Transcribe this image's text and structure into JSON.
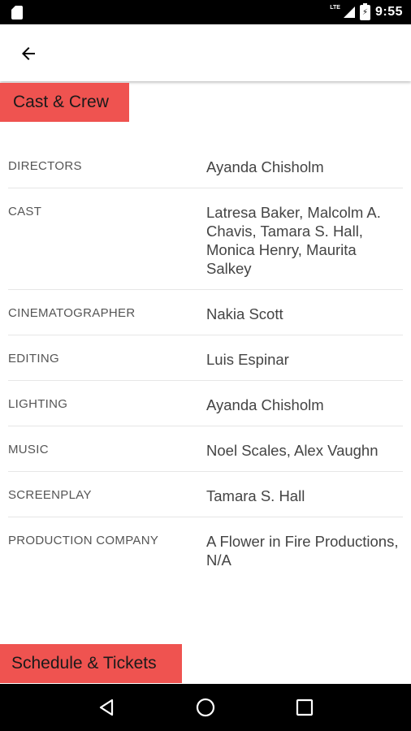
{
  "status_bar": {
    "time": "9:55",
    "network": "LTE",
    "icons": [
      "sim-icon",
      "lte-signal-icon",
      "battery-charging-icon"
    ]
  },
  "app_bar": {
    "back_icon": "arrow-back-icon"
  },
  "cast_section": {
    "title": "Cast & Crew"
  },
  "credits": [
    {
      "label": "DIRECTORS",
      "value": "Ayanda Chisholm"
    },
    {
      "label": "CAST",
      "value": "Latresa Baker, Malcolm A. Chavis, Tamara S. Hall, Monica Henry, Maurita Salkey"
    },
    {
      "label": "CINEMATOGRAPHER",
      "value": "Nakia Scott"
    },
    {
      "label": "EDITING",
      "value": "Luis Espinar"
    },
    {
      "label": "LIGHTING",
      "value": "Ayanda Chisholm"
    },
    {
      "label": "MUSIC",
      "value": "Noel Scales, Alex Vaughn"
    },
    {
      "label": "SCREENPLAY",
      "value": "Tamara S. Hall"
    },
    {
      "label": "PRODUCTION COMPANY",
      "value": "A Flower in Fire Productions, N/A"
    }
  ],
  "schedule_section": {
    "title": "Schedule & Tickets"
  },
  "nav_bar": {
    "icons": [
      "back-triangle-icon",
      "home-circle-icon",
      "recents-square-icon"
    ]
  },
  "colors": {
    "accent": "#ef5350",
    "status_bar": "#000000",
    "nav_bar": "#000000"
  }
}
